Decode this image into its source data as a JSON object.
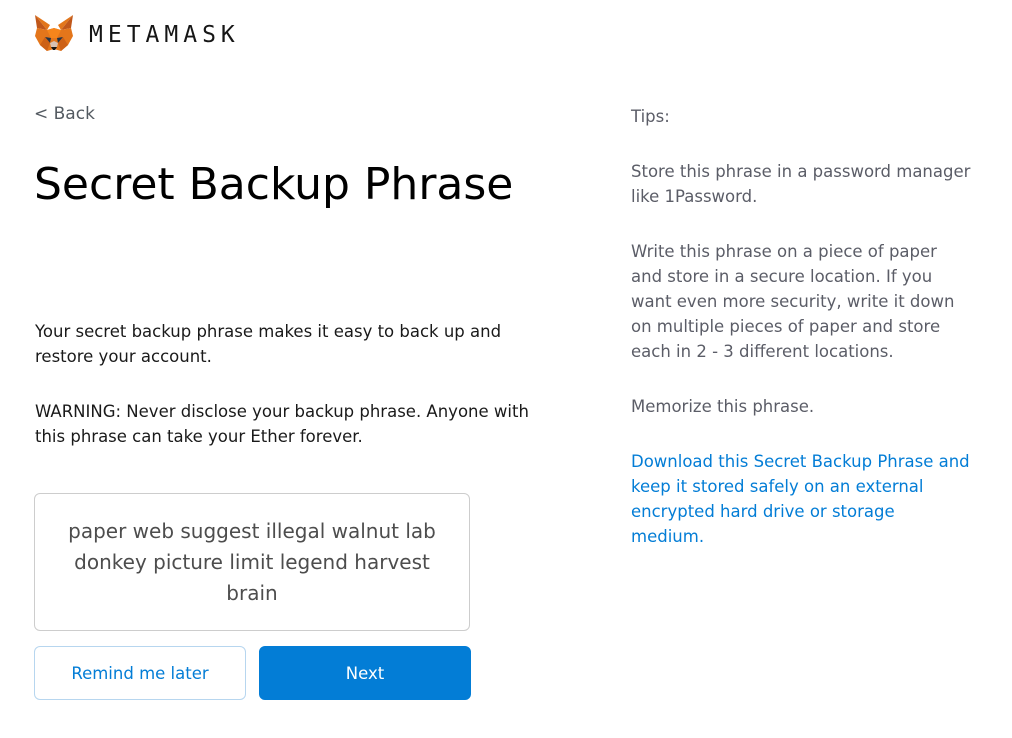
{
  "header": {
    "brand": "METAMASK",
    "logo_icon": "metamask-fox-icon"
  },
  "nav": {
    "back_label": "< Back"
  },
  "main": {
    "title": "Secret Backup Phrase",
    "description": "Your secret backup phrase makes it easy to back up and restore your account.",
    "warning": "WARNING: Never disclose your backup phrase. Anyone with this phrase can take your Ether forever.",
    "phrase": "paper web suggest illegal walnut lab donkey picture limit legend harvest brain",
    "remind_label": "Remind me later",
    "next_label": "Next"
  },
  "tips": {
    "title": "Tips:",
    "tip_password_manager": "Store this phrase in a password manager like 1Password.",
    "tip_paper": "Write this phrase on a piece of paper and store in a secure location. If you want even more security, write it down on multiple pieces of paper and store each in 2 - 3 different locations.",
    "tip_memorize": "Memorize this phrase.",
    "tip_download_link": "Download this Secret Backup Phrase and keep it stored safely on an external encrypted hard drive or storage medium."
  },
  "colors": {
    "accent": "#037dd6",
    "fox_orange": "#e2761b",
    "text_dark": "#000000",
    "text_muted": "#5b5d67"
  }
}
